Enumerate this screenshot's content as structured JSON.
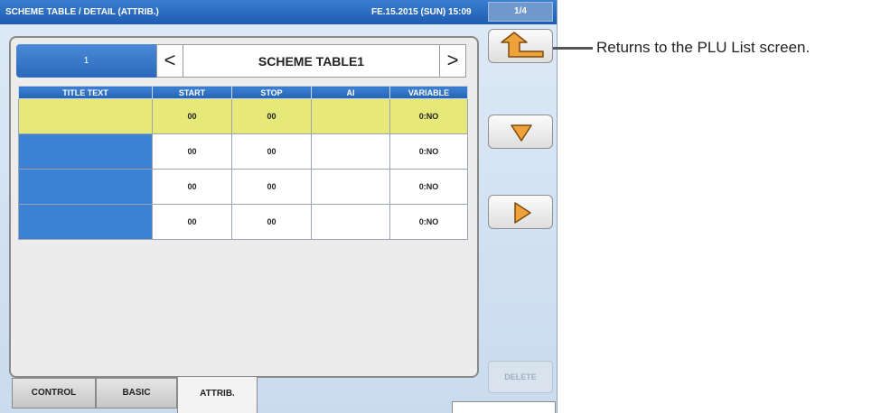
{
  "titlebar": {
    "title": "SCHEME TABLE / DETAIL (ATTRIB.)",
    "datetime": "FE.15.2015 (SUN) 15:09",
    "page_indicator": "1/4"
  },
  "navigator": {
    "page_number": "1",
    "prev_label": "<",
    "next_label": ">",
    "table_name": "SCHEME TABLE1"
  },
  "table": {
    "columns": [
      "TITLE TEXT",
      "START",
      "STOP",
      "AI",
      "VARIABLE"
    ],
    "rows": [
      {
        "title": "",
        "start": "00",
        "stop": "00",
        "ai": "",
        "variable": "0:NO",
        "selected": true
      },
      {
        "title": "",
        "start": "00",
        "stop": "00",
        "ai": "",
        "variable": "0:NO",
        "selected": false
      },
      {
        "title": "",
        "start": "00",
        "stop": "00",
        "ai": "",
        "variable": "0:NO",
        "selected": false
      },
      {
        "title": "",
        "start": "00",
        "stop": "00",
        "ai": "",
        "variable": "0:NO",
        "selected": false
      }
    ]
  },
  "tabs": {
    "control": "CONTROL",
    "basic": "BASIC",
    "attrib": "ATTRIB."
  },
  "side_buttons": {
    "back_icon": "return-arrow-icon",
    "down_icon": "triangle-down-icon",
    "right_icon": "triangle-right-icon",
    "delete_label": "DELETE"
  },
  "annotation": {
    "text": "Returns to the PLU List screen."
  },
  "colors": {
    "titlebar_blue": "#1d5cb0",
    "header_blue": "#2363b6",
    "selected_row": "#e6e878",
    "icon_orange": "#f0a23a"
  }
}
